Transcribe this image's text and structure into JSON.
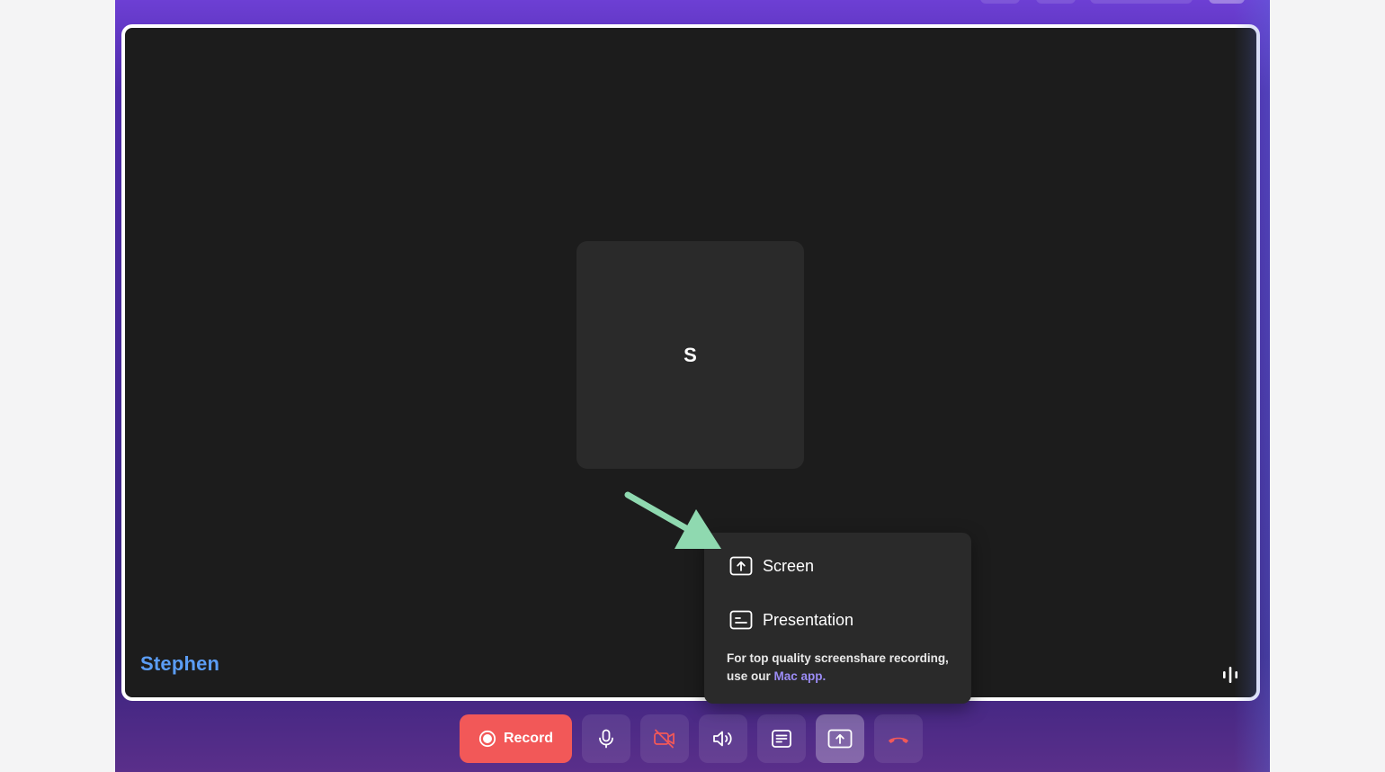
{
  "participant": {
    "initial": "S",
    "name": "Stephen"
  },
  "share_menu": {
    "items": [
      {
        "label": "Screen",
        "icon": "screen-share-icon"
      },
      {
        "label": "Presentation",
        "icon": "presentation-icon"
      }
    ],
    "note_prefix": "For top quality screenshare recording, use our ",
    "note_link": "Mac app",
    "note_suffix": "."
  },
  "toolbar": {
    "record_label": "Record",
    "buttons": [
      {
        "icon": "microphone-icon"
      },
      {
        "icon": "camera-off-icon"
      },
      {
        "icon": "speaker-icon"
      },
      {
        "icon": "captions-icon"
      },
      {
        "icon": "share-screen-icon",
        "active": true
      },
      {
        "icon": "hang-up-icon"
      }
    ]
  },
  "colors": {
    "accent_record": "#f25858",
    "name_label": "#5b9df5",
    "link": "#9b8cf5",
    "annotation_arrow": "#8fd9b0",
    "stage_bg": "#1c1c1c"
  }
}
